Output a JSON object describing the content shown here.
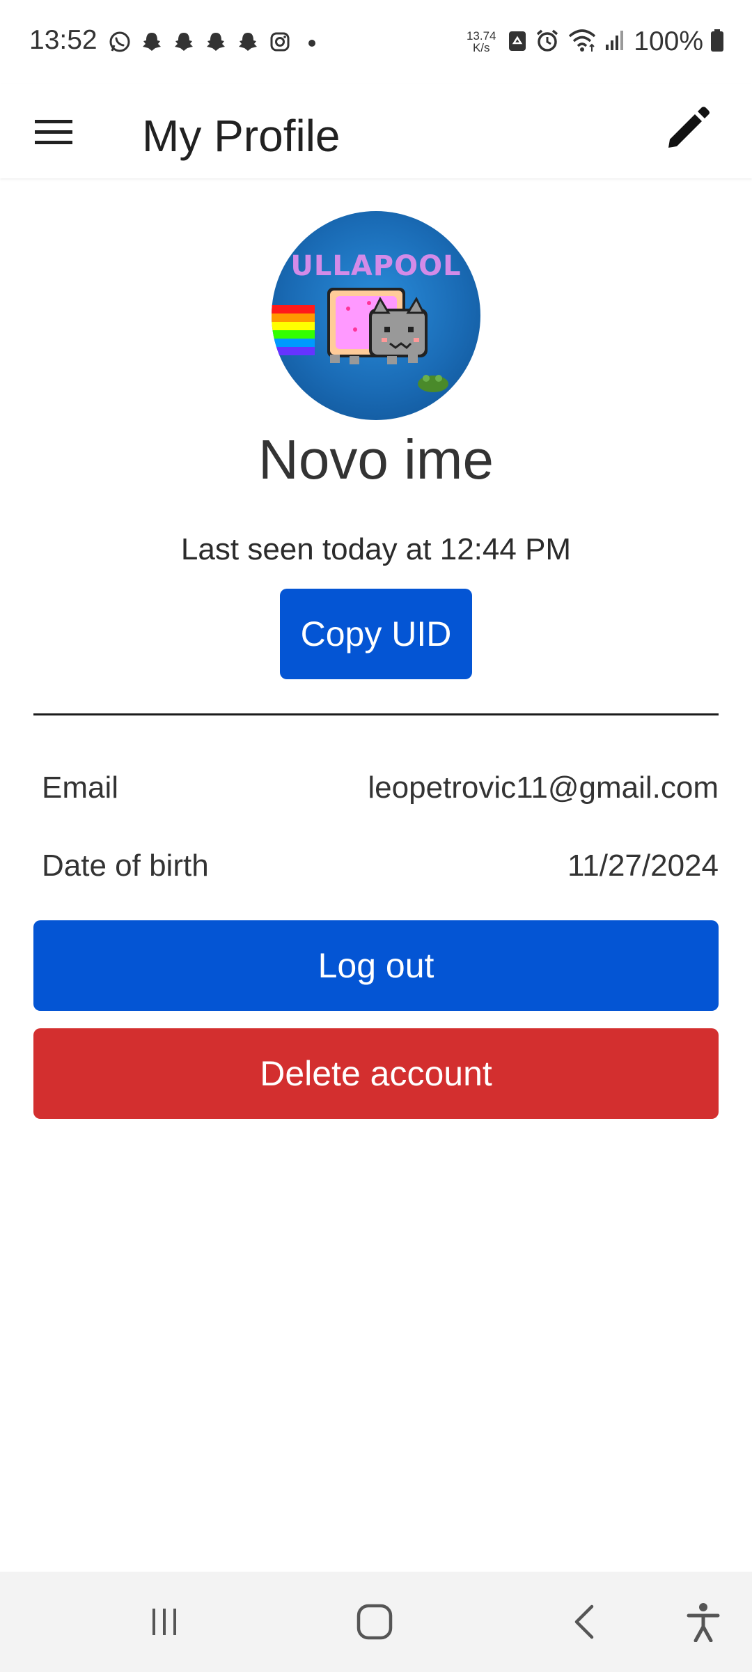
{
  "status_bar": {
    "time": "13:52",
    "notification_icons": [
      "whatsapp-icon",
      "snapchat-icon",
      "snapchat-icon",
      "snapchat-icon",
      "snapchat-icon",
      "instagram-icon",
      "dot-icon"
    ],
    "net_speed_value": "13.74",
    "net_speed_unit": "K/s",
    "battery_percent": "100%"
  },
  "app_bar": {
    "title": "My Profile",
    "menu_icon": "hamburger-menu-icon",
    "edit_icon": "pencil-icon"
  },
  "profile": {
    "avatar_text": "ULLAPOOL",
    "name": "Novo ime",
    "last_seen": "Last seen today at 12:44 PM",
    "copy_uid_label": "Copy UID"
  },
  "details": {
    "email_label": "Email",
    "email_value": "leopetrovic11@gmail.com",
    "dob_label": "Date of birth",
    "dob_value": "11/27/2024"
  },
  "actions": {
    "logout_label": "Log out",
    "delete_label": "Delete account"
  },
  "colors": {
    "primary": "#0455d4",
    "danger": "#d32f2f",
    "background": "#ffffff"
  }
}
